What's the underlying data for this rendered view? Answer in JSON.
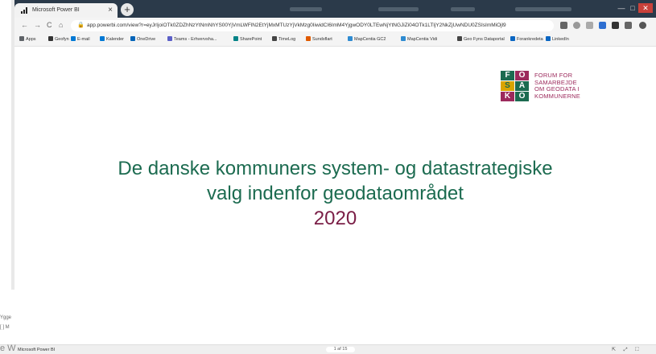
{
  "browser": {
    "tab_title": "Microsoft Power BI",
    "tab_close": "×",
    "new_tab": "+",
    "win_min": "—",
    "win_max": "□",
    "win_close": "✕",
    "nav_back": "←",
    "nav_forward": "→",
    "nav_reload": "C",
    "nav_home": "⌂",
    "lock": "🔒",
    "url": "app.powerbi.com/view?r=eyJrIjoiOTk0ZDZhNzYtNmNhYS00YjVmLWFlN2EtYjMxMTUzYjVkMzg0IiwidCI6ImM4YjgwODY0LTEwNjYtNGJiZi04OTk1LTljY2NkZjUwNDU0ZSIsImMiOjl9",
    "colors": {
      "tabstrip": "#2b3a4a",
      "accent": "#1c6b50"
    }
  },
  "bookmarks": [
    {
      "label": "Apps",
      "color": "#5f6368"
    },
    {
      "label": "Geofyn",
      "color": "#333333"
    },
    {
      "label": "E-mail",
      "color": "#0078d4"
    },
    {
      "label": "Kalender",
      "color": "#0078d4"
    },
    {
      "label": "OneDrive",
      "color": "#0364b8"
    },
    {
      "label": "Teams - Erhvervsha...",
      "color": "#5b5fc7"
    },
    {
      "label": "SharePoint",
      "color": "#038387"
    },
    {
      "label": "TimeLog",
      "color": "#444444"
    },
    {
      "label": "Sundsflart",
      "color": "#e05a00"
    },
    {
      "label": "MapCentia GC2",
      "color": "#2e8bd1"
    },
    {
      "label": "MapCentia Vidi",
      "color": "#2e8bd1"
    },
    {
      "label": "Geo Fyns Dataportal",
      "color": "#444444"
    },
    {
      "label": "Forankredeta",
      "color": "#0a66c2"
    },
    {
      "label": "LinkedIn",
      "color": "#0a66c2"
    }
  ],
  "slide": {
    "logo_letters": [
      "F",
      "O",
      "S",
      "A",
      "K",
      "O"
    ],
    "logo_text_lines": [
      "FORUM FOR",
      "SAMARBEJDE",
      "OM GEODATA I",
      "KOMMUNERNE"
    ],
    "heading_line1": "De danske kommuners system- og datastrategiske",
    "heading_line2": "valg indenfor geodataområdet",
    "year": "2020",
    "colors": {
      "heading": "#1c6b50",
      "year": "#7a1e46"
    }
  },
  "bottom": {
    "app_name": "Microsoft Power BI",
    "page_indicator": "1 af 15",
    "icons": "⇱ ⤢ ⛶"
  },
  "left_fragment": {
    "text1": "Ygge",
    "text2": "[ ] M",
    "text3": "e W"
  }
}
